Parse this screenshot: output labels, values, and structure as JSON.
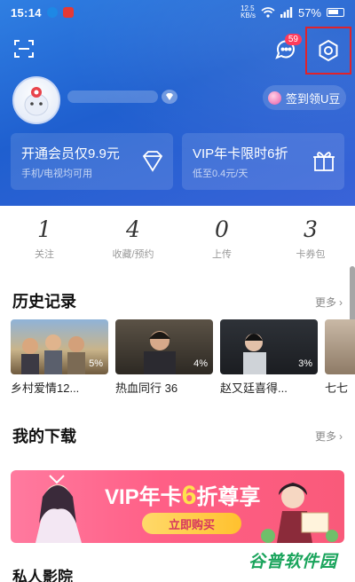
{
  "status_bar": {
    "time": "15:14",
    "net_top": "12.5",
    "net_bottom": "KB/s",
    "battery": "57%"
  },
  "header": {
    "messages_badge": "59",
    "settings_highlight_color": "#e0222a"
  },
  "profile": {
    "checkin_label": "签到领U豆"
  },
  "vip_cards": [
    {
      "title": "开通会员仅9.9元",
      "subtitle": "手机/电视均可用",
      "icon": "diamond-icon"
    },
    {
      "title": "VIP年卡限时6折",
      "subtitle": "低至0.4元/天",
      "icon": "gift-icon"
    }
  ],
  "stats": [
    {
      "value": "1",
      "label": "关注"
    },
    {
      "value": "4",
      "label": "收藏/预约"
    },
    {
      "value": "0",
      "label": "上传"
    },
    {
      "value": "3",
      "label": "卡券包"
    }
  ],
  "history": {
    "title": "历史记录",
    "more": "更多",
    "items": [
      {
        "title": "乡村爱情12...",
        "progress": "5%"
      },
      {
        "title": "热血同行 36",
        "progress": "4%"
      },
      {
        "title": "赵又廷喜得...",
        "progress": "3%"
      },
      {
        "title": "七七",
        "progress": ""
      }
    ]
  },
  "downloads": {
    "title": "我的下载",
    "more": "更多"
  },
  "banner": {
    "prefix": "VIP年卡",
    "six": "6",
    "suffix": "折尊享",
    "button": "立即购买"
  },
  "private_theater": {
    "title": "私人影院"
  },
  "watermark": "谷普软件园",
  "colors": {
    "hero": "#2a6fdc",
    "banner": "#ff5f86",
    "badge": "#ff3b5c"
  }
}
